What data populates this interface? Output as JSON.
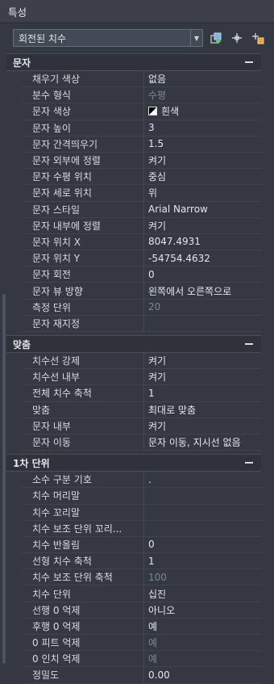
{
  "title": "특성",
  "selector": {
    "value": "회전된 치수"
  },
  "sections": [
    {
      "title": "문자",
      "rows": [
        {
          "label": "채우기 색상",
          "value": "없음"
        },
        {
          "label": "분수 형식",
          "value": "수평",
          "dim": true
        },
        {
          "label": "문자 색상",
          "value": "흰색",
          "swatch": true
        },
        {
          "label": "문자 높이",
          "value": "3"
        },
        {
          "label": "문자 간격띄우기",
          "value": "1.5"
        },
        {
          "label": "문자 외부에 정렬",
          "value": "켜기"
        },
        {
          "label": "문자 수평 위치",
          "value": "중심"
        },
        {
          "label": "문자 세로 위치",
          "value": "위"
        },
        {
          "label": "문자 스타일",
          "value": "Arial Narrow"
        },
        {
          "label": "문자 내부에 정렬",
          "value": "켜기"
        },
        {
          "label": "문자 위치 X",
          "value": "8047.4931"
        },
        {
          "label": "문자 위치 Y",
          "value": "-54754.4632"
        },
        {
          "label": "문자 회전",
          "value": "0"
        },
        {
          "label": "문자 뷰 방향",
          "value": "왼쪽에서 오른쪽으로"
        },
        {
          "label": "측정 단위",
          "value": "20",
          "dim": true
        },
        {
          "label": "문자 재지정",
          "value": ""
        }
      ]
    },
    {
      "title": "맞춤",
      "rows": [
        {
          "label": "치수선 강제",
          "value": "켜기"
        },
        {
          "label": "치수선 내부",
          "value": "켜기"
        },
        {
          "label": "전체 치수 축척",
          "value": "1"
        },
        {
          "label": "맞춤",
          "value": "최대로 맞춤"
        },
        {
          "label": "문자 내부",
          "value": "켜기"
        },
        {
          "label": "문자 이동",
          "value": "문자 이동, 지시선 없음"
        }
      ]
    },
    {
      "title": "1차 단위",
      "rows": [
        {
          "label": "소수 구분 기호",
          "value": "."
        },
        {
          "label": "치수 머리말",
          "value": ""
        },
        {
          "label": "치수 꼬리말",
          "value": ""
        },
        {
          "label": "치수 보조 단위 꼬리...",
          "value": ""
        },
        {
          "label": "치수 반올림",
          "value": "0"
        },
        {
          "label": "선형 치수 축척",
          "value": "1"
        },
        {
          "label": "치수 보조 단위 축척",
          "value": "100",
          "dim": true
        },
        {
          "label": "치수 단위",
          "value": "십진"
        },
        {
          "label": "선행 0 억제",
          "value": "아니오"
        },
        {
          "label": "후행 0 억제",
          "value": "예"
        },
        {
          "label": "0 피트 억제",
          "value": "예",
          "dim": true
        },
        {
          "label": "0 인치 억제",
          "value": "예",
          "dim": true
        },
        {
          "label": "정밀도",
          "value": "0.00"
        }
      ]
    }
  ]
}
